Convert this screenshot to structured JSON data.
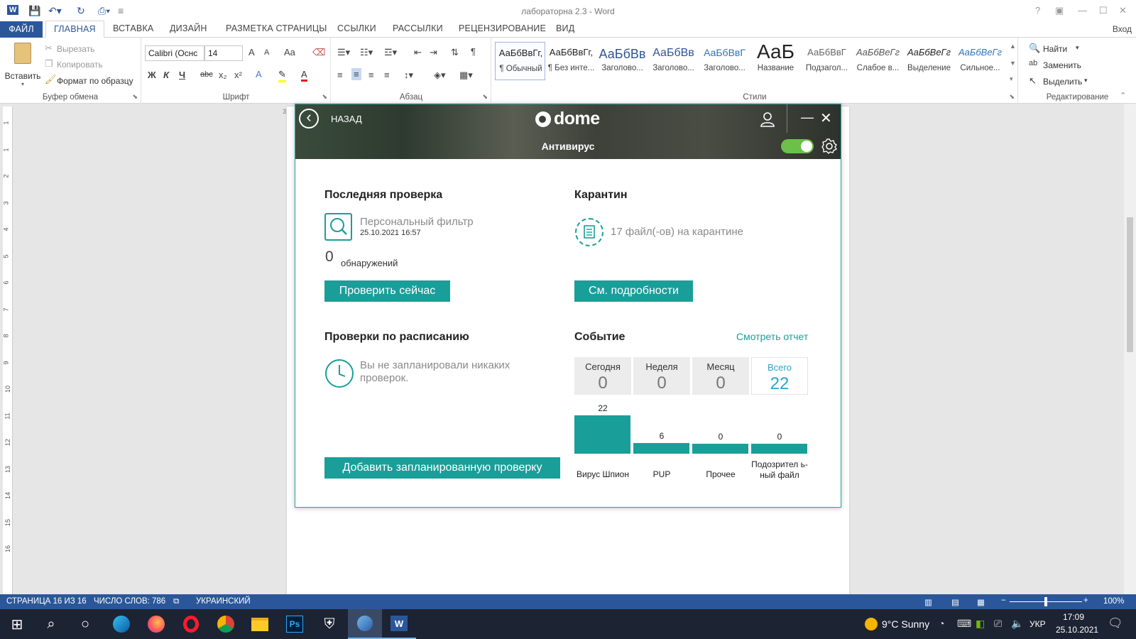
{
  "word": {
    "title": "лабораторна 2.3 - Word",
    "help": "?",
    "login": "Вход",
    "tabs": [
      "ФАЙЛ",
      "ГЛАВНАЯ",
      "ВСТАВКА",
      "ДИЗАЙН",
      "РАЗМЕТКА СТРАНИЦЫ",
      "ССЫЛКИ",
      "РАССЫЛКИ",
      "РЕЦЕНЗИРОВАНИЕ",
      "ВИД"
    ],
    "clipboard": {
      "paste": "Вставить",
      "cut": "Вырезать",
      "copy": "Копировать",
      "format_painter": "Формат по образцу",
      "label": "Буфер обмена"
    },
    "font": {
      "name": "Calibri (Оснс",
      "size": "14",
      "label": "Шрифт",
      "bold": "Ж",
      "italic": "К",
      "underline": "Ч",
      "strike": "abc",
      "sub": "x₂",
      "sup": "x²",
      "case": "Aa",
      "grow": "A",
      "shrink": "A",
      "effects": "A",
      "color": "A"
    },
    "paragraph": {
      "label": "Абзац",
      "pilcrow": "¶"
    },
    "styles": {
      "label": "Стили",
      "items": [
        {
          "sample": "АаБбВвГг,",
          "name": "¶ Обычный"
        },
        {
          "sample": "АаБбВвГг,",
          "name": "¶ Без инте..."
        },
        {
          "sample": "АаБбВв",
          "name": "Заголово..."
        },
        {
          "sample": "АаБбВв",
          "name": "Заголово..."
        },
        {
          "sample": "АаБбВвГ",
          "name": "Заголово..."
        },
        {
          "sample": "АаБ",
          "name": "Название"
        },
        {
          "sample": "АаБбВвГ",
          "name": "Подзагол..."
        },
        {
          "sample": "АаБбВеГг",
          "name": "Слабое в..."
        },
        {
          "sample": "АаБбВеГг",
          "name": "Выделение"
        },
        {
          "sample": "АаБбВеГг",
          "name": "Сильное..."
        }
      ]
    },
    "editing": {
      "label": "Редактирование",
      "find": "Найти",
      "replace": "Заменить",
      "select": "Выделить"
    },
    "ruler_nums": [
      "1",
      "1",
      "2",
      "3",
      "4",
      "5",
      "6",
      "7",
      "8",
      "9",
      "10",
      "11",
      "12",
      "13",
      "14",
      "15",
      "16"
    ],
    "status": {
      "page": "СТРАНИЦА 16 ИЗ 16",
      "words": "ЧИСЛО СЛОВ: 786",
      "lang": "УКРАИНСКИЙ",
      "zoom": "100%",
      "zoom_level": 1.0
    }
  },
  "dome": {
    "back": "НАЗАД",
    "logo": "dome",
    "module": "Антивирус",
    "enabled": true,
    "last_scan": {
      "title": "Последняя проверка",
      "scan_name": "Персональный фильтр",
      "date": "25.10.2021 16:57",
      "count": "0",
      "detections": "обнаружений",
      "button": "Проверить сейчас"
    },
    "quarantine": {
      "title": "Карантин",
      "info": "17 файл(-ов) на карантине",
      "button": "См. подробности"
    },
    "scheduled": {
      "title": "Проверки по расписанию",
      "info": "Вы не запланировали никаких проверок.",
      "button": "Добавить запланированную проверку"
    },
    "events": {
      "title": "Событие",
      "report_link": "Смотреть отчет",
      "stats": [
        {
          "label": "Сегодня",
          "value": "0"
        },
        {
          "label": "Неделя",
          "value": "0"
        },
        {
          "label": "Месяц",
          "value": "0"
        },
        {
          "label": "Всего",
          "value": "22"
        }
      ]
    },
    "colors": {
      "accent": "#1a9e9a",
      "toggle_on": "#6cc04a",
      "total_text": "#2aa5c8"
    }
  },
  "chart_data": {
    "type": "bar",
    "categories": [
      "Вирус Шпион",
      "PUP",
      "Прочее",
      "Подозрител ь- ный файл"
    ],
    "values": [
      22,
      6,
      0,
      0
    ],
    "ylim": [
      0,
      22
    ]
  },
  "taskbar": {
    "weather": "9°C  Sunny",
    "lang": "УКР",
    "time": "17:09",
    "date": "25.10.2021",
    "icons": [
      "windows-start-icon",
      "search-icon",
      "task-view-icon",
      "edge-icon",
      "firefox-icon",
      "opera-icon",
      "chrome-icon",
      "file-explorer-icon",
      "photoshop-icon",
      "security-icon",
      "dome-app-icon",
      "word-app-icon"
    ]
  }
}
